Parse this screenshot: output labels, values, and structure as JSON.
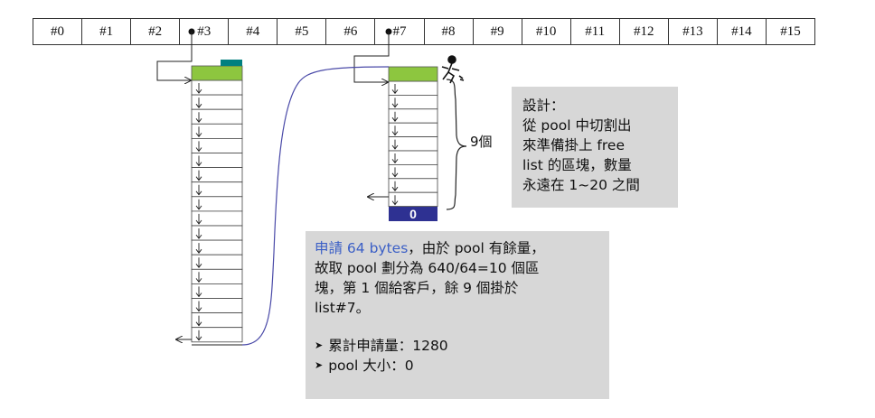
{
  "slots": [
    "#0",
    "#1",
    "#2",
    "#3",
    "#4",
    "#5",
    "#6",
    "#7",
    "#8",
    "#9",
    "#10",
    "#11",
    "#12",
    "#13",
    "#14",
    "#15"
  ],
  "zero_block_label": "0",
  "count_label": "9個",
  "design_note": {
    "lines": [
      "設計：",
      "從 pool 中切割出",
      "來準備掛上 free",
      "list 的區塊，數量",
      "永遠在 1~20 之間"
    ]
  },
  "info_note": {
    "line1_highlight": "申請 64 bytes",
    "line1_rest": "，由於 pool 有餘量，",
    "line2": "故取 pool 劃分為 640/64=10 個區",
    "line3": "塊，第 1 個給客戶，餘 9 個掛於",
    "line4": "list#7。",
    "bullets": [
      "累計申請量：1280",
      "pool 大小：0"
    ]
  },
  "colors": {
    "block_green": "#8dc63f",
    "block_teal": "#008080",
    "block_navy": "#2e3192",
    "note_bg": "#d7d7d7",
    "curve": "#4a4aa8"
  },
  "icons": [
    "bullet-arrow-icon",
    "person-icon"
  ]
}
